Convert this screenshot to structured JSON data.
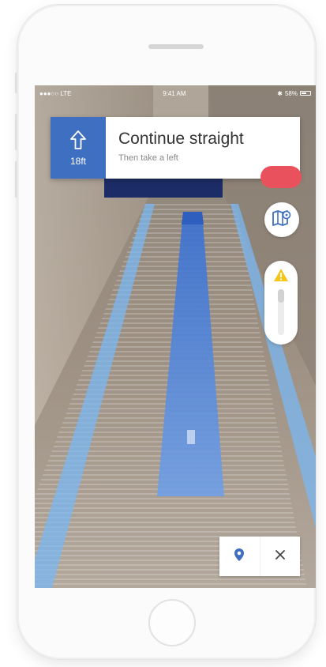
{
  "status_bar": {
    "carrier": "●●●○○ LTE",
    "time": "9:41 AM",
    "battery": "58%",
    "bluetooth": "✱"
  },
  "navigation": {
    "instruction": "Continue straight",
    "next_step": "Then take a left",
    "distance": "18ft",
    "direction_icon": "arrow-up-icon"
  },
  "controls": {
    "map_icon": "map-icon",
    "warning_icon": "warning-triangle-icon",
    "location_icon": "location-pin-icon",
    "close_icon": "close-icon"
  },
  "slider": {
    "level": 0.3
  },
  "colors": {
    "nav_blue": "#3f6fc1",
    "route_blue": "#3a7bd5",
    "alert_red": "#e9525c",
    "warning_yellow": "#f5c518"
  }
}
